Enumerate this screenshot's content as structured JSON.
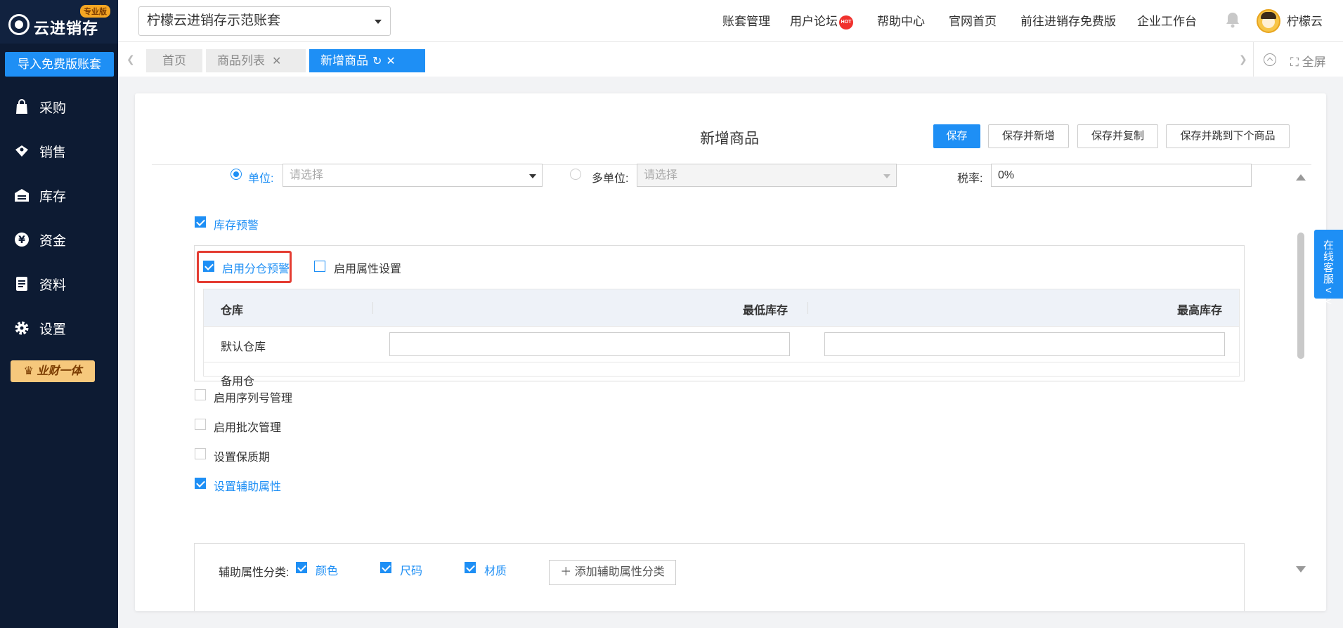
{
  "sidebar": {
    "logo_text": "云进销存",
    "logo_badge": "专业版",
    "import_button": "导入免费版账套",
    "items": [
      {
        "label": "采购",
        "icon": "bag-icon"
      },
      {
        "label": "销售",
        "icon": "tag-icon"
      },
      {
        "label": "库存",
        "icon": "warehouse-icon"
      },
      {
        "label": "资金",
        "icon": "yen-icon"
      },
      {
        "label": "资料",
        "icon": "document-icon"
      },
      {
        "label": "设置",
        "icon": "gear-icon"
      }
    ],
    "brand_button": "业财一体"
  },
  "header": {
    "account": "柠檬云进销存示范账套",
    "links": [
      "账套管理",
      "用户论坛",
      "帮助中心",
      "官网首页",
      "前往进销存免费版",
      "企业工作台"
    ],
    "hot_badge": "HOT",
    "user": "柠檬云"
  },
  "tabs": {
    "items": [
      {
        "label": "首页",
        "active": false,
        "closable": false
      },
      {
        "label": "商品列表",
        "active": false,
        "closable": true
      },
      {
        "label": "新增商品",
        "active": true,
        "closable": true
      }
    ],
    "fullscreen": "全屏"
  },
  "form": {
    "title": "新增商品",
    "buttons": [
      "保存",
      "保存并新增",
      "保存并复制",
      "保存并跳到下个商品"
    ],
    "unit_label": "单位:",
    "unit_placeholder": "请选择",
    "multi_unit_label": "多单位:",
    "multi_unit_placeholder": "请选择",
    "tax_label": "税率:",
    "tax_value": "0%",
    "stock_warning": {
      "label": "库存预警",
      "checked": true
    },
    "branch_warning": {
      "label": "启用分仓预警",
      "checked": true
    },
    "attr_setting": {
      "label": "启用属性设置",
      "checked": false
    },
    "table": {
      "headers": [
        "仓库",
        "最低库存",
        "最高库存"
      ],
      "rows": [
        {
          "warehouse": "默认仓库",
          "min": "",
          "max": ""
        },
        {
          "warehouse": "备用仓",
          "min": "",
          "max": ""
        }
      ]
    },
    "serial_mgmt": {
      "label": "启用序列号管理",
      "checked": false
    },
    "batch_mgmt": {
      "label": "启用批次管理",
      "checked": false
    },
    "shelf_life": {
      "label": "设置保质期",
      "checked": false
    },
    "aux_attr": {
      "label": "设置辅助属性",
      "checked": true
    },
    "aux_category_label": "辅助属性分类:",
    "aux_options": [
      {
        "label": "颜色",
        "checked": true
      },
      {
        "label": "尺码",
        "checked": true
      },
      {
        "label": "材质",
        "checked": true
      }
    ],
    "add_aux_button": "添加辅助属性分类"
  },
  "service": {
    "label": "在线客服<<"
  },
  "colors": {
    "primary": "#1e8ff5",
    "sidebar": "#0d1b33",
    "highlight": "#e43c32"
  }
}
